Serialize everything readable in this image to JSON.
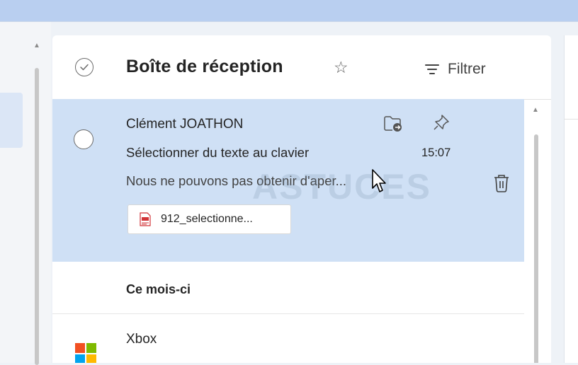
{
  "header": {
    "title": "Boîte de réception",
    "filter_label": "Filtrer"
  },
  "selected_message": {
    "sender": "Clément JOATHON",
    "subject": "Sélectionner du texte au clavier",
    "time": "15:07",
    "preview": "Nous ne pouvons pas obtenir d'aper...",
    "attachment": {
      "name": "912_selectionne...",
      "icon": "pdf-icon"
    },
    "watermark": "ASTUCES"
  },
  "group": {
    "label": "Ce mois-ci"
  },
  "next_message": {
    "sender": "Xbox",
    "logo_colors": [
      "#f25022",
      "#7fba00",
      "#00a4ef",
      "#ffb900"
    ]
  },
  "colors": {
    "selected_bg": "#cfe0f5",
    "top_bar": "#b9cff0"
  }
}
